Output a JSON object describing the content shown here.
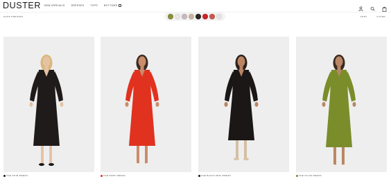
{
  "brand": {
    "logo": "DUSTER"
  },
  "nav": {
    "items": [
      "New Arrivals",
      "Dresses",
      "Tops",
      "Bottoms"
    ],
    "gift_icon": "gift-icon"
  },
  "header_icons": [
    "user-icon",
    "search-icon",
    "bag-icon"
  ],
  "filter": {
    "breadcrumb": "Shop Dresses",
    "sort_label": "Sort",
    "filter_label": "Filter",
    "color_swatches": [
      "#8a8f3a",
      "#e9e7e6",
      "#c7b9bd",
      "#c9b4a4",
      "#2a2624",
      "#c8262a",
      "#c45a50",
      "#e4e4e4"
    ]
  },
  "products": [
    {
      "name": "The Noir Dress",
      "color": "#1f1b1a",
      "dot_color": "#1f1b1a"
    },
    {
      "name": "The Ruby Dress",
      "color": "#e0321f",
      "dot_color": "#e0321f"
    },
    {
      "name": "The Black Midi Dress",
      "color": "#1a1716",
      "dot_color": "#1a1716"
    },
    {
      "name": "The Olive Dress",
      "color": "#7a8d2a",
      "dot_color": "#7a8d2a"
    }
  ]
}
